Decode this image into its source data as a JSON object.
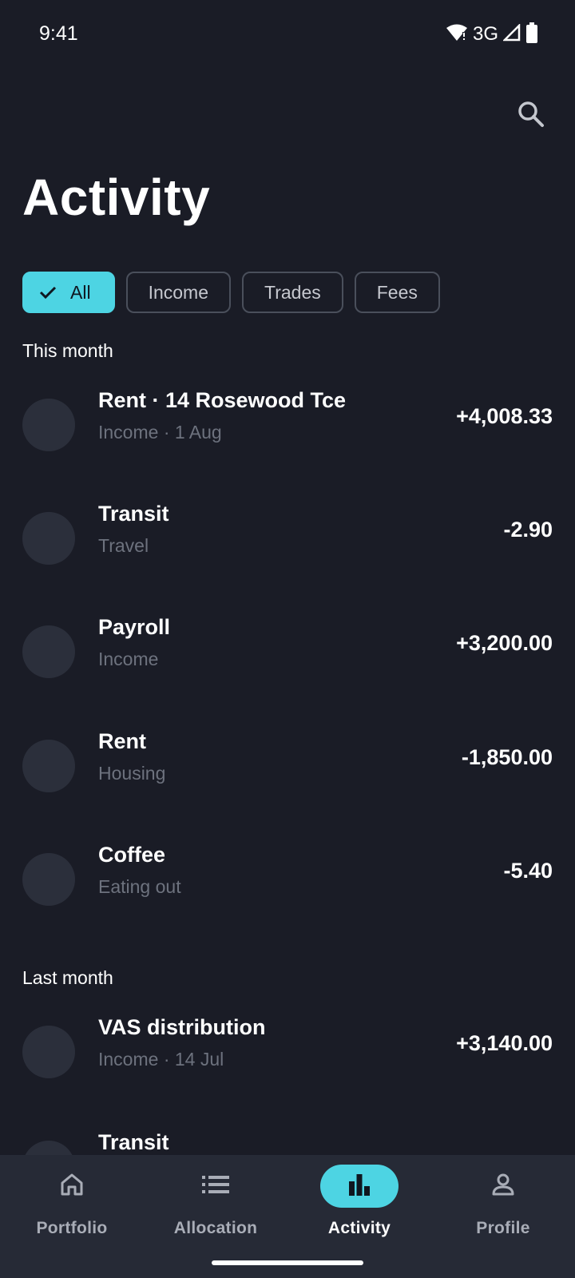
{
  "status": {
    "time": "9:41",
    "network": "3G"
  },
  "header": {
    "title": "Activity",
    "search_icon": "search-icon"
  },
  "filters": [
    {
      "label": "All",
      "active": true
    },
    {
      "label": "Income",
      "active": false
    },
    {
      "label": "Trades",
      "active": false
    },
    {
      "label": "Fees",
      "active": false
    }
  ],
  "sections": [
    {
      "title": "This month",
      "items": [
        {
          "title": "Rent · 14 Rosewood Tce",
          "subtitle": "Income · 1 Aug",
          "amount": "+4,008.33"
        },
        {
          "title": "Transit",
          "subtitle": "Travel",
          "amount": "-2.90"
        },
        {
          "title": "Payroll",
          "subtitle": "Income",
          "amount": "+3,200.00"
        },
        {
          "title": "Rent",
          "subtitle": "Housing",
          "amount": "-1,850.00"
        },
        {
          "title": "Coffee",
          "subtitle": "Eating out",
          "amount": "-5.40"
        }
      ]
    },
    {
      "title": "Last month",
      "items": [
        {
          "title": "VAS distribution",
          "subtitle": "Income · 14 Jul",
          "amount": "+3,140.00"
        },
        {
          "title": "Transit",
          "subtitle": "",
          "amount": ""
        }
      ]
    }
  ],
  "nav": [
    {
      "label": "Portfolio",
      "icon": "home-icon",
      "active": false
    },
    {
      "label": "Allocation",
      "icon": "list-icon",
      "active": false
    },
    {
      "label": "Activity",
      "icon": "bar-chart-icon",
      "active": true
    },
    {
      "label": "Profile",
      "icon": "person-icon",
      "active": false
    }
  ],
  "colors": {
    "background": "#1a1c26",
    "accent": "#4dd4e3",
    "nav_background": "#262a36",
    "avatar": "#2b2f3b"
  }
}
